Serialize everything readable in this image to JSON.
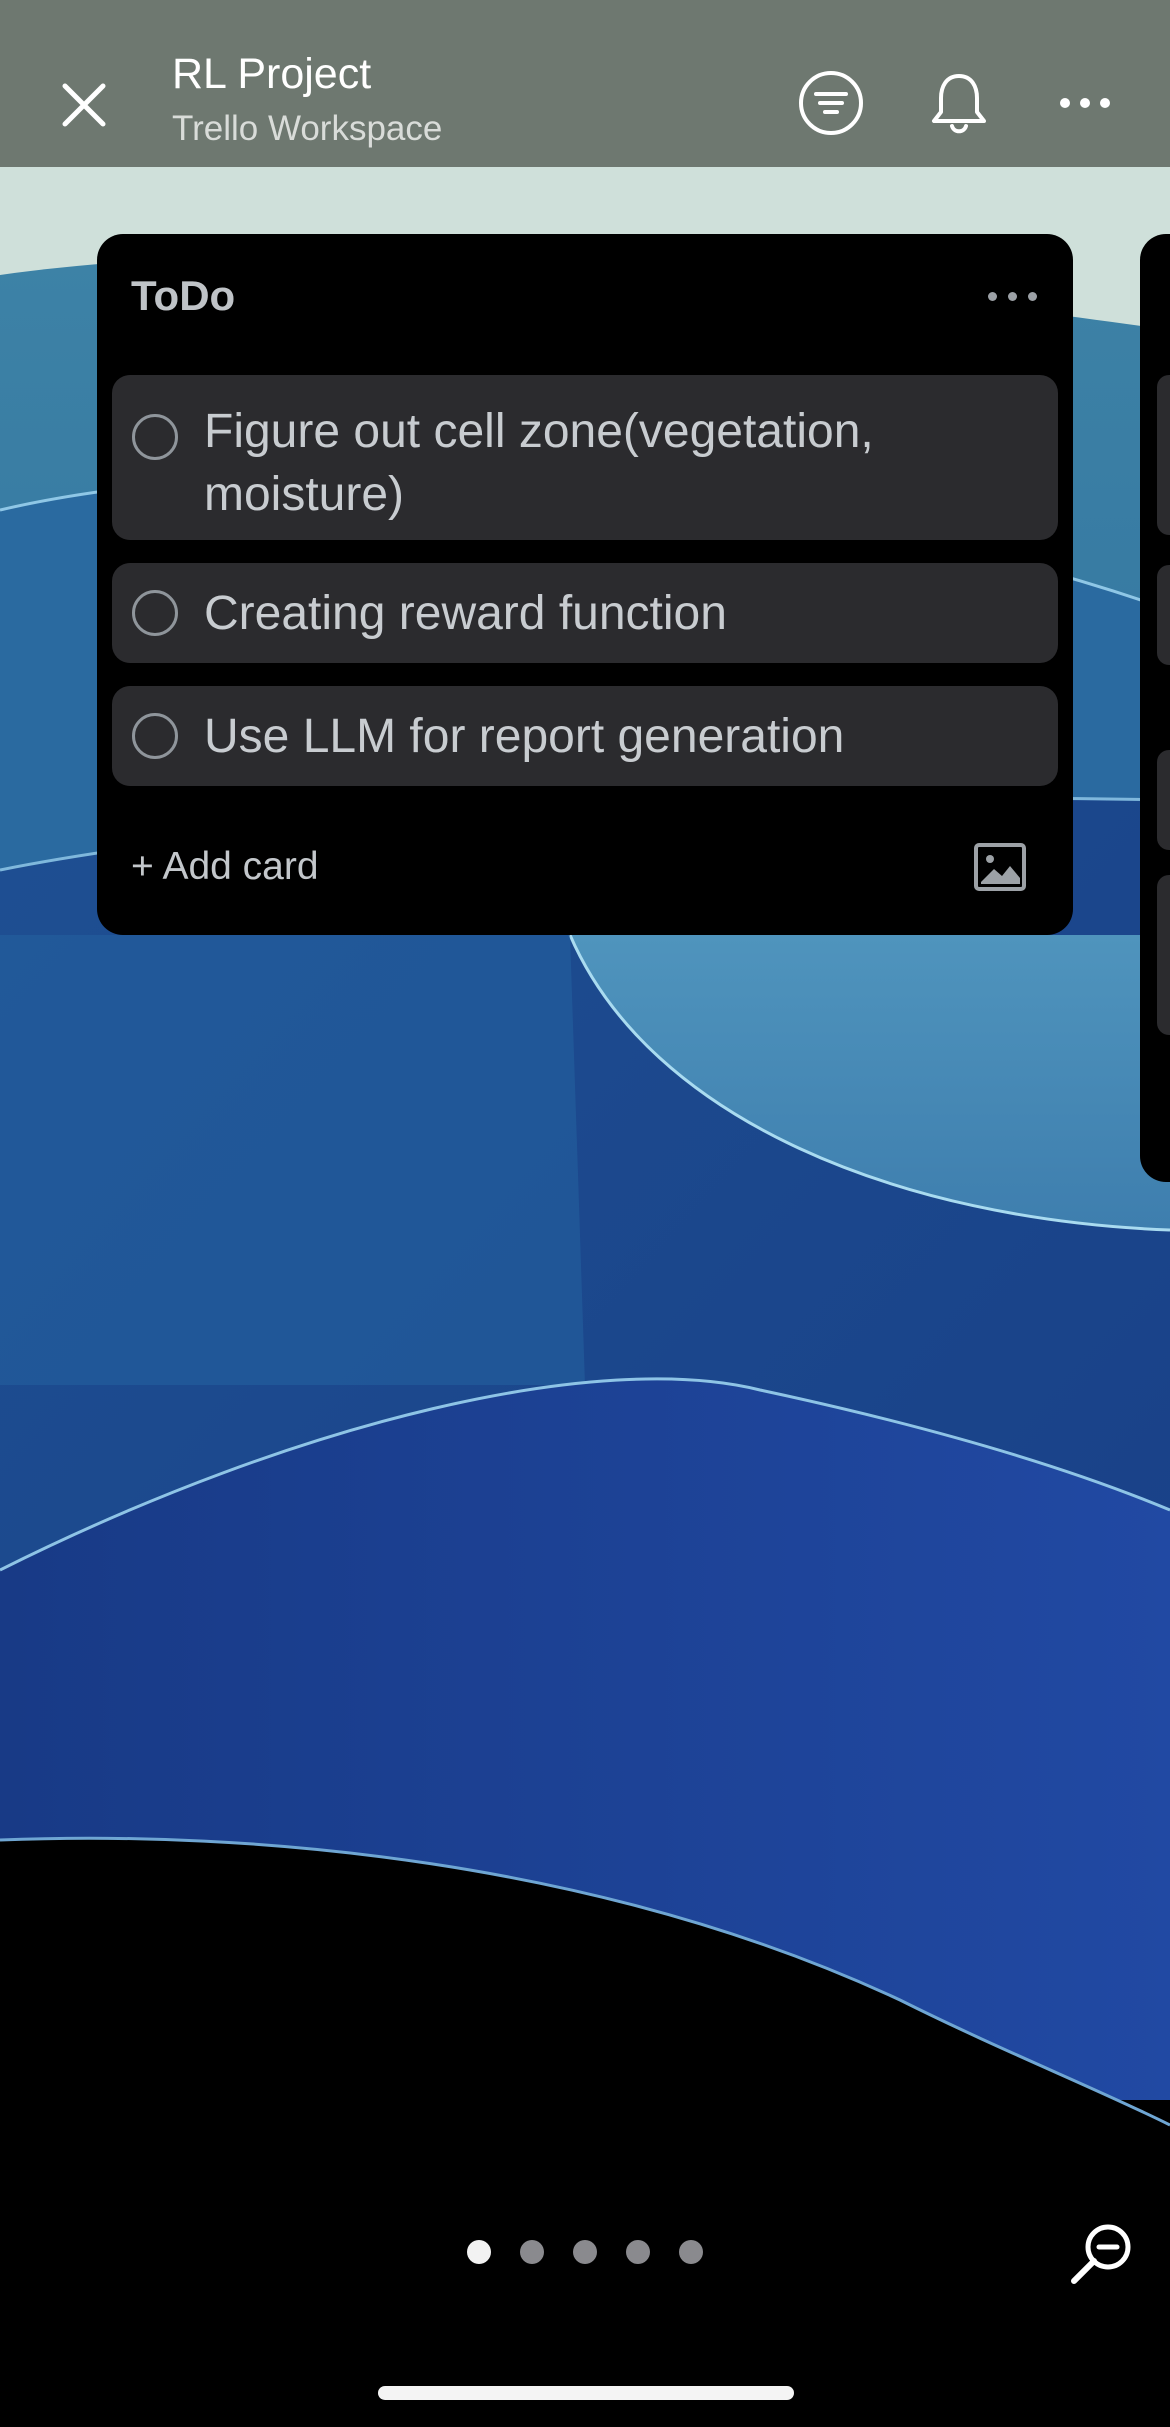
{
  "header": {
    "board_title": "RL Project",
    "workspace": "Trello Workspace",
    "close_icon": "close-icon",
    "filter_icon": "filter-icon",
    "bell_icon": "bell-icon",
    "more_icon": "more-icon",
    "background_color": "#6e7870"
  },
  "list": {
    "title": "ToDo",
    "cards": [
      {
        "text": "Figure out cell zone(vegetation, moisture)"
      },
      {
        "text": "Creating reward function"
      },
      {
        "text": "Use LLM for report generation"
      }
    ],
    "add_card_label": "+ Add card",
    "image_icon": "image-icon"
  },
  "pager": {
    "page_count": 5,
    "current_page": 1
  },
  "zoom_icon": "zoom-out-icon"
}
